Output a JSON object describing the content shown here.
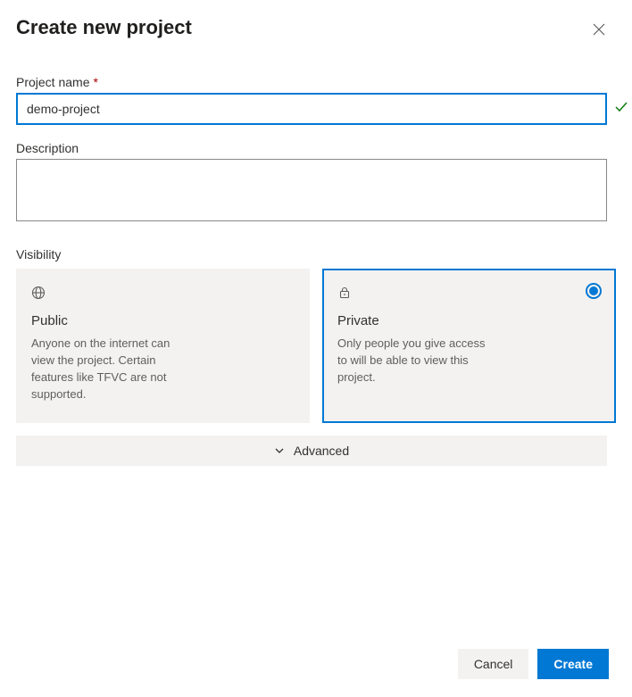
{
  "header": {
    "title": "Create new project"
  },
  "projectName": {
    "label": "Project name",
    "required": "*",
    "value": "demo-project"
  },
  "description": {
    "label": "Description",
    "value": ""
  },
  "visibility": {
    "label": "Visibility",
    "options": [
      {
        "title": "Public",
        "desc": "Anyone on the internet can view the project. Certain features like TFVC are not supported.",
        "selected": false
      },
      {
        "title": "Private",
        "desc": "Only people you give access to will be able to view this project.",
        "selected": true
      }
    ]
  },
  "advanced": {
    "label": "Advanced"
  },
  "footer": {
    "cancel": "Cancel",
    "create": "Create"
  }
}
